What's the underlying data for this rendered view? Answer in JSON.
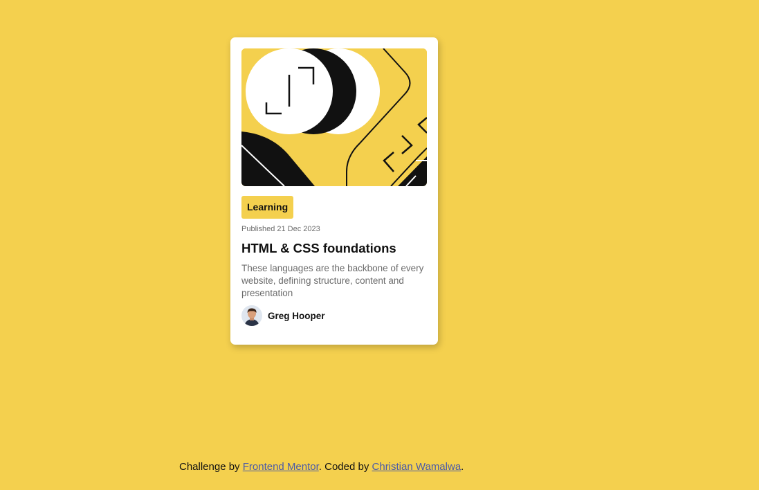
{
  "card": {
    "hero_image": "illustration-article",
    "tag": "Learning",
    "published": "Published 21 Dec 2023",
    "title": "HTML & CSS foundations",
    "description": "These languages are the backbone of every website, defining structure, content and presentation",
    "author": {
      "avatar": "avatar-image",
      "name": "Greg Hooper"
    }
  },
  "attribution": {
    "prefix": "Challenge by ",
    "link1": "Frontend Mentor",
    "middle": ". Coded by ",
    "link2": "Christian Wamalwa",
    "suffix": "."
  },
  "colors": {
    "background": "#f4d04e",
    "card": "#ffffff",
    "text": "#111111",
    "muted": "#6b6b6b",
    "link": "#4a5aa8"
  }
}
